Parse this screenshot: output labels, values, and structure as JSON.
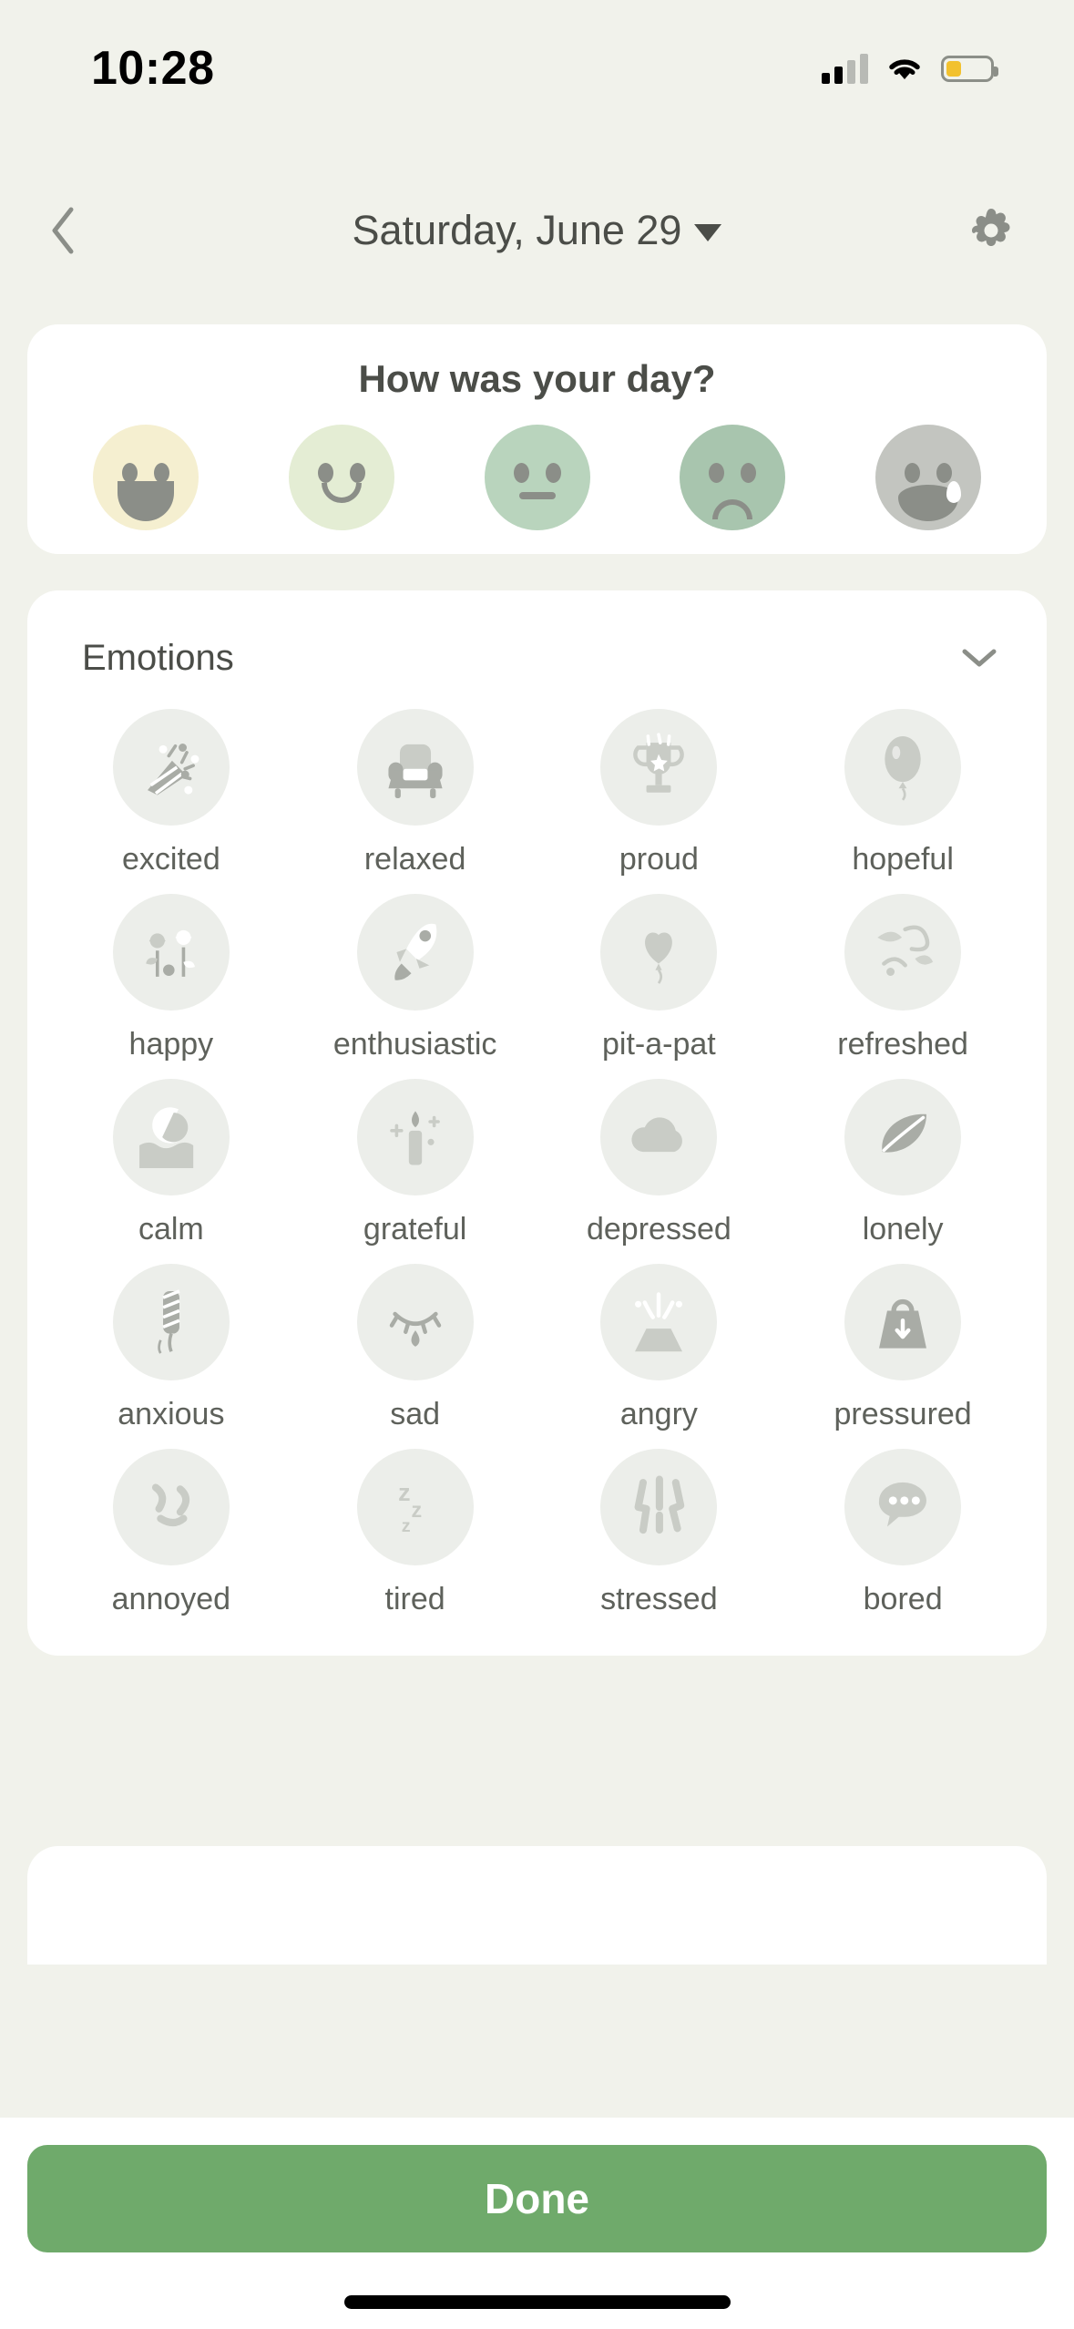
{
  "status_bar": {
    "time": "10:28",
    "signal_icon": "cellular-signal-icon",
    "signal_bars_filled": 2,
    "signal_bars_total": 4,
    "wifi_icon": "wifi-icon",
    "battery_icon": "battery-low-icon",
    "battery_level_pct": 34,
    "battery_color": "#f2c12e"
  },
  "header": {
    "back_icon": "chevron-left-icon",
    "date_title": "Saturday, June 29",
    "date_caret_icon": "caret-down-icon",
    "settings_icon": "gear-icon"
  },
  "mood_card": {
    "question": "How was your day?",
    "faces": [
      {
        "name": "very-happy",
        "color": "#f5efd0",
        "expression": "big-smile"
      },
      {
        "name": "happy",
        "color": "#e4edd4",
        "expression": "smile"
      },
      {
        "name": "neutral",
        "color": "#b9d4bd",
        "expression": "flat"
      },
      {
        "name": "sad",
        "color": "#a8c5ae",
        "expression": "frown"
      },
      {
        "name": "very-sad",
        "color": "#c3c5c0",
        "expression": "crying"
      }
    ]
  },
  "emotions_card": {
    "title": "Emotions",
    "collapse_icon": "chevron-down-icon",
    "items": [
      {
        "label": "excited",
        "icon": "party-popper-icon"
      },
      {
        "label": "relaxed",
        "icon": "armchair-icon"
      },
      {
        "label": "proud",
        "icon": "trophy-icon"
      },
      {
        "label": "hopeful",
        "icon": "balloon-icon"
      },
      {
        "label": "happy",
        "icon": "flowers-icon"
      },
      {
        "label": "enthusiastic",
        "icon": "rocket-icon"
      },
      {
        "label": "pit-a-pat",
        "icon": "heart-balloon-icon"
      },
      {
        "label": "refreshed",
        "icon": "breeze-icon"
      },
      {
        "label": "calm",
        "icon": "moon-water-icon"
      },
      {
        "label": "grateful",
        "icon": "candle-icon"
      },
      {
        "label": "depressed",
        "icon": "cloud-icon"
      },
      {
        "label": "lonely",
        "icon": "leaf-icon"
      },
      {
        "label": "anxious",
        "icon": "twisted-rope-icon"
      },
      {
        "label": "sad",
        "icon": "crying-eye-icon"
      },
      {
        "label": "angry",
        "icon": "volcano-icon"
      },
      {
        "label": "pressured",
        "icon": "weight-icon"
      },
      {
        "label": "annoyed",
        "icon": "squiggles-icon"
      },
      {
        "label": "tired",
        "icon": "zzz-icon"
      },
      {
        "label": "stressed",
        "icon": "lightning-icon"
      },
      {
        "label": "bored",
        "icon": "speech-bubble-icon"
      }
    ]
  },
  "footer": {
    "done_label": "Done",
    "done_color": "#6faa6b",
    "home_indicator": "home-indicator"
  }
}
